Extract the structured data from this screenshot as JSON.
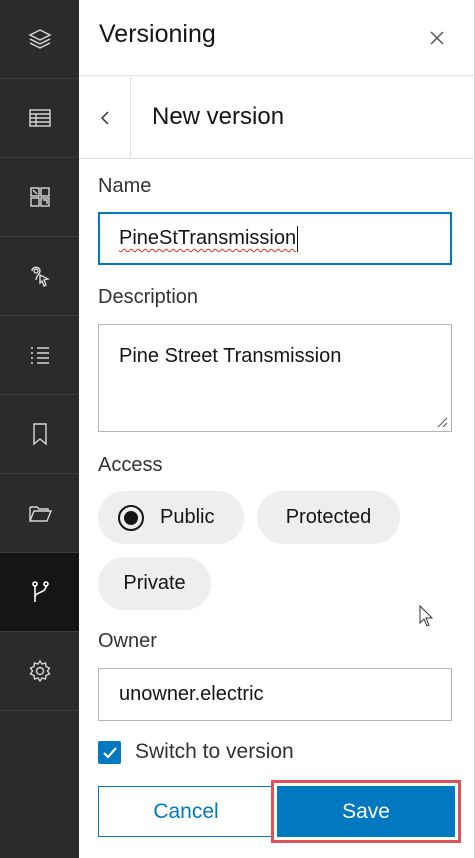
{
  "rail": {
    "items": [
      {
        "icon": "layers-icon"
      },
      {
        "icon": "table-icon"
      },
      {
        "icon": "grid-qr-icon"
      },
      {
        "icon": "select-cursor-icon"
      },
      {
        "icon": "list-icon"
      },
      {
        "icon": "bookmark-icon"
      },
      {
        "icon": "folder-open-icon"
      },
      {
        "icon": "branch-icon",
        "active": true
      },
      {
        "icon": "gear-icon"
      }
    ]
  },
  "panel": {
    "title": "Versioning",
    "subtitle": "New version"
  },
  "form": {
    "name_label": "Name",
    "name_value": "PineStTransmission",
    "description_label": "Description",
    "description_value": "Pine Street Transmission",
    "access_label": "Access",
    "access_options": [
      "Public",
      "Protected",
      "Private"
    ],
    "access_selected": "Public",
    "owner_label": "Owner",
    "owner_value": "unowner.electric",
    "switch_label": "Switch to version",
    "switch_checked": true
  },
  "buttons": {
    "cancel": "Cancel",
    "save": "Save"
  },
  "colors": {
    "accent": "#0079c1",
    "rail_bg": "#2b2b2b",
    "highlight": "#e0525a"
  }
}
